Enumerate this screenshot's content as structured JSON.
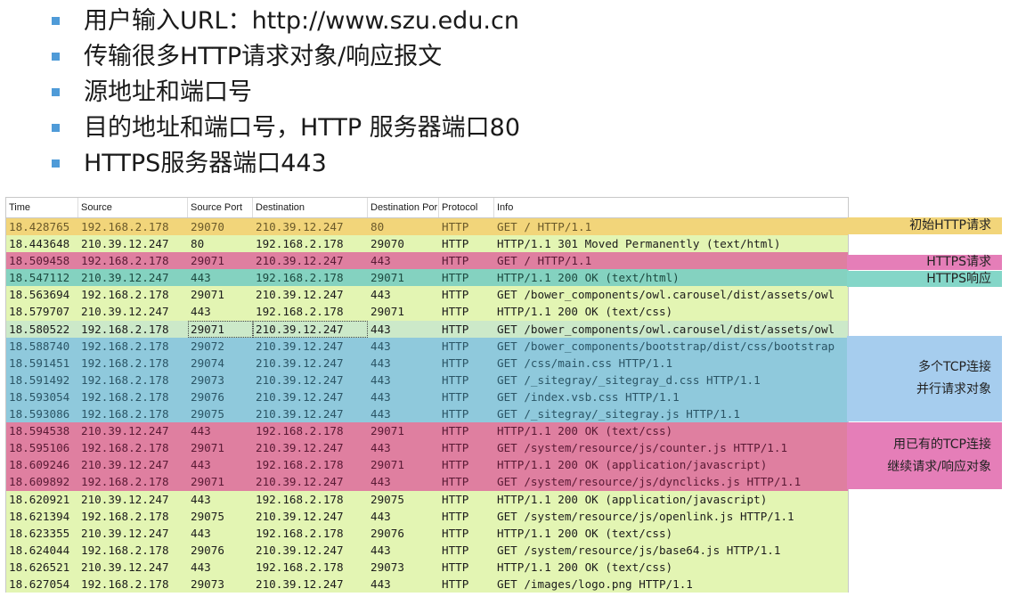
{
  "bullets": [
    "用户输入URL：http://www.szu.edu.cn",
    "传输很多HTTP请求对象/响应报文",
    "源地址和端口号",
    "目的地址和端口号，HTTP 服务器端口80",
    "HTTPS服务器端口443"
  ],
  "table": {
    "headers": [
      "Time",
      "Source",
      "Source Port",
      "Destination",
      "Destination Por",
      "Protocol",
      "Info"
    ],
    "rows": [
      {
        "cells": [
          "18.428765",
          "192.168.2.178",
          "29070",
          "210.39.12.247",
          "80",
          "HTTP",
          "GET / HTTP/1.1"
        ],
        "bg": "#f2d57a",
        "fg": "#6b5a2a"
      },
      {
        "cells": [
          "18.443648",
          "210.39.12.247",
          "80",
          "192.168.2.178",
          "29070",
          "HTTP",
          "HTTP/1.1 301 Moved Permanently  (text/html)"
        ],
        "bg": "#e3f5b3",
        "fg": "#1c1c1c"
      },
      {
        "cells": [
          "18.509458",
          "192.168.2.178",
          "29071",
          "210.39.12.247",
          "443",
          "HTTP",
          "GET / HTTP/1.1"
        ],
        "bg": "#df7fa0",
        "fg": "#5a1a35"
      },
      {
        "cells": [
          "18.547112",
          "210.39.12.247",
          "443",
          "192.168.2.178",
          "29071",
          "HTTP",
          "HTTP/1.1 200 OK  (text/html)"
        ],
        "bg": "#84d2c0",
        "fg": "#1d4a40"
      },
      {
        "cells": [
          "18.563694",
          "192.168.2.178",
          "29071",
          "210.39.12.247",
          "443",
          "HTTP",
          "GET /bower_components/owl.carousel/dist/assets/owl"
        ],
        "bg": "#e3f5b3",
        "fg": "#1c1c1c"
      },
      {
        "cells": [
          "18.579707",
          "210.39.12.247",
          "443",
          "192.168.2.178",
          "29071",
          "HTTP",
          "HTTP/1.1 200 OK  (text/css)"
        ],
        "bg": "#e3f5b3",
        "fg": "#1c1c1c"
      },
      {
        "cells": [
          "18.580522",
          "192.168.2.178",
          "29071",
          "210.39.12.247",
          "443",
          "HTTP",
          "GET /bower_components/owl.carousel/dist/assets/owl"
        ],
        "bg": "#cce9c9",
        "fg": "#1c1c1c",
        "selected": true
      },
      {
        "cells": [
          "18.588740",
          "192.168.2.178",
          "29072",
          "210.39.12.247",
          "443",
          "HTTP",
          "GET /bower_components/bootstrap/dist/css/bootstrap"
        ],
        "bg": "#8fc9dc",
        "fg": "#2b5566"
      },
      {
        "cells": [
          "18.591451",
          "192.168.2.178",
          "29074",
          "210.39.12.247",
          "443",
          "HTTP",
          "GET /css/main.css HTTP/1.1"
        ],
        "bg": "#8fc9dc",
        "fg": "#2b5566"
      },
      {
        "cells": [
          "18.591492",
          "192.168.2.178",
          "29073",
          "210.39.12.247",
          "443",
          "HTTP",
          "GET /_sitegray/_sitegray_d.css HTTP/1.1"
        ],
        "bg": "#8fc9dc",
        "fg": "#2b5566"
      },
      {
        "cells": [
          "18.593054",
          "192.168.2.178",
          "29076",
          "210.39.12.247",
          "443",
          "HTTP",
          "GET /index.vsb.css HTTP/1.1"
        ],
        "bg": "#8fc9dc",
        "fg": "#2b5566"
      },
      {
        "cells": [
          "18.593086",
          "192.168.2.178",
          "29075",
          "210.39.12.247",
          "443",
          "HTTP",
          "GET /_sitegray/_sitegray.js HTTP/1.1"
        ],
        "bg": "#8fc9dc",
        "fg": "#2b5566"
      },
      {
        "cells": [
          "18.594538",
          "210.39.12.247",
          "443",
          "192.168.2.178",
          "29071",
          "HTTP",
          "HTTP/1.1 200 OK  (text/css)"
        ],
        "bg": "#df7fa0",
        "fg": "#5a1a35"
      },
      {
        "cells": [
          "18.595106",
          "192.168.2.178",
          "29071",
          "210.39.12.247",
          "443",
          "HTTP",
          "GET /system/resource/js/counter.js HTTP/1.1"
        ],
        "bg": "#df7fa0",
        "fg": "#5a1a35"
      },
      {
        "cells": [
          "18.609246",
          "210.39.12.247",
          "443",
          "192.168.2.178",
          "29071",
          "HTTP",
          "HTTP/1.1 200 OK  (application/javascript)"
        ],
        "bg": "#df7fa0",
        "fg": "#5a1a35"
      },
      {
        "cells": [
          "18.609892",
          "192.168.2.178",
          "29071",
          "210.39.12.247",
          "443",
          "HTTP",
          "GET /system/resource/js/dynclicks.js HTTP/1.1"
        ],
        "bg": "#df7fa0",
        "fg": "#5a1a35"
      },
      {
        "cells": [
          "18.620921",
          "210.39.12.247",
          "443",
          "192.168.2.178",
          "29075",
          "HTTP",
          "HTTP/1.1 200 OK  (application/javascript)"
        ],
        "bg": "#e3f5b3",
        "fg": "#1c1c1c"
      },
      {
        "cells": [
          "18.621394",
          "192.168.2.178",
          "29075",
          "210.39.12.247",
          "443",
          "HTTP",
          "GET /system/resource/js/openlink.js HTTP/1.1"
        ],
        "bg": "#e3f5b3",
        "fg": "#1c1c1c"
      },
      {
        "cells": [
          "18.623355",
          "210.39.12.247",
          "443",
          "192.168.2.178",
          "29076",
          "HTTP",
          "HTTP/1.1 200 OK  (text/css)"
        ],
        "bg": "#e3f5b3",
        "fg": "#1c1c1c"
      },
      {
        "cells": [
          "18.624044",
          "192.168.2.178",
          "29076",
          "210.39.12.247",
          "443",
          "HTTP",
          "GET /system/resource/js/base64.js HTTP/1.1"
        ],
        "bg": "#e3f5b3",
        "fg": "#1c1c1c"
      },
      {
        "cells": [
          "18.626521",
          "210.39.12.247",
          "443",
          "192.168.2.178",
          "29073",
          "HTTP",
          "HTTP/1.1 200 OK  (text/css)"
        ],
        "bg": "#e3f5b3",
        "fg": "#1c1c1c"
      },
      {
        "cells": [
          "18.627054",
          "192.168.2.178",
          "29073",
          "210.39.12.247",
          "443",
          "HTTP",
          "GET /images/logo.png HTTP/1.1"
        ],
        "bg": "#e3f5b3",
        "fg": "#1c1c1c"
      }
    ]
  },
  "annotations": {
    "initial": {
      "lines": [
        "初始HTTP请求"
      ],
      "bg": "#f2d57a"
    },
    "https_request": {
      "lines": [
        "HTTPS请求"
      ],
      "bg": "#e57eb8"
    },
    "https_response": {
      "lines": [
        "HTTPS响应"
      ],
      "bg": "#84d6c8"
    },
    "parallel": {
      "lines": [
        "多个TCP连接",
        "并行请求对象"
      ],
      "bg": "#a6cdee"
    },
    "reuse": {
      "lines": [
        "用已有的TCP连接",
        "继续请求/响应对象"
      ],
      "bg": "#e57eb8"
    }
  },
  "colors": {
    "bullet": "#4f9bd8"
  }
}
